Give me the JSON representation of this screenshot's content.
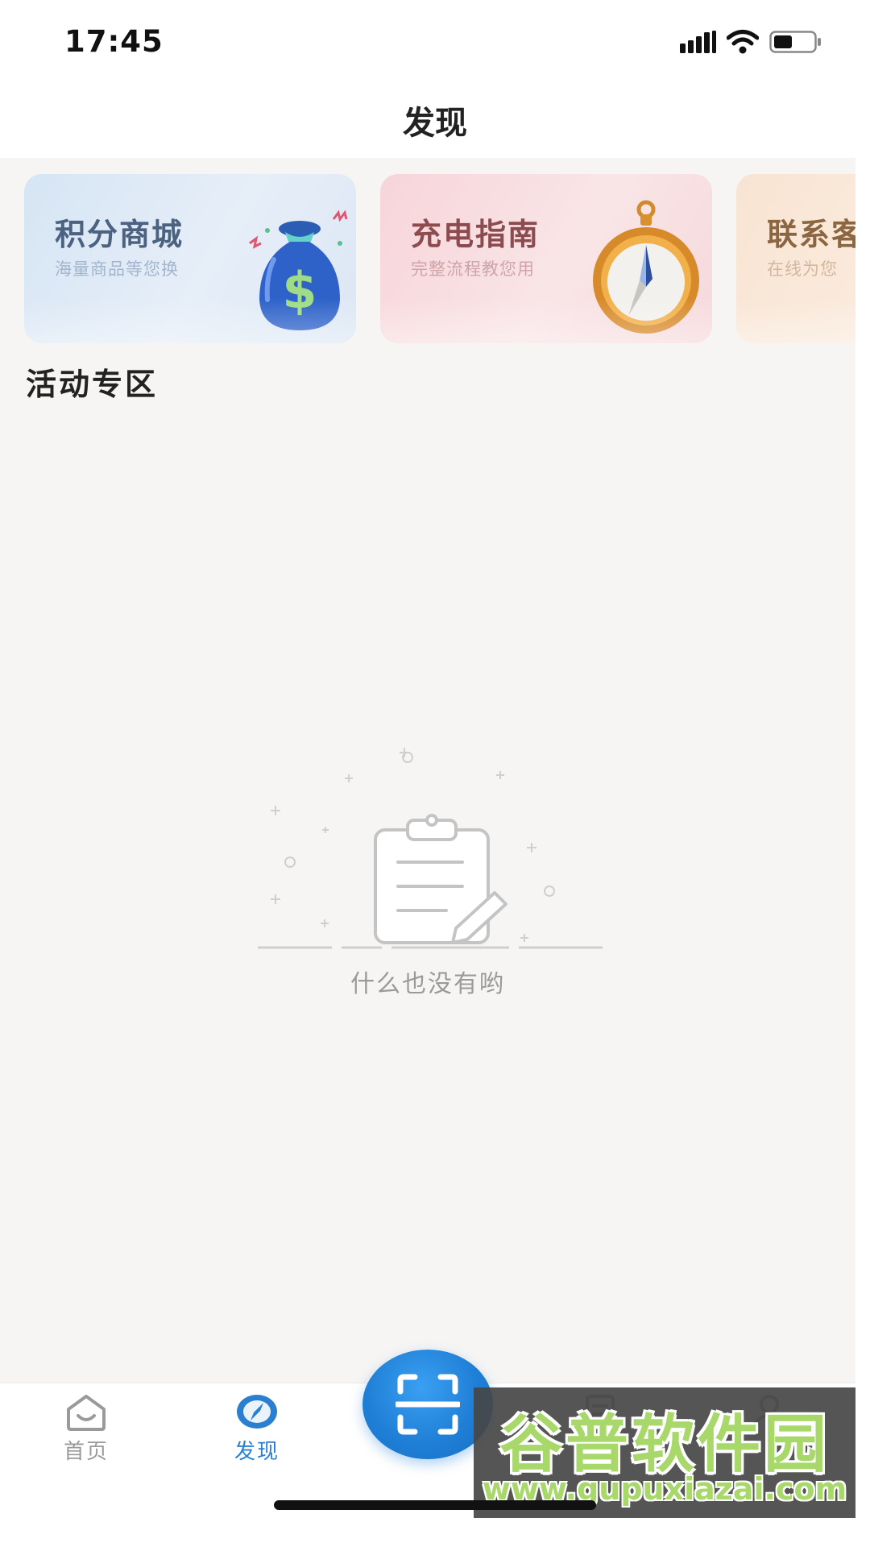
{
  "status_bar": {
    "time": "17:45",
    "icons": [
      "signal-icon",
      "wifi-icon",
      "battery-icon"
    ]
  },
  "header": {
    "title": "发现"
  },
  "feature_cards": [
    {
      "title": "积分商城",
      "subtitle": "海量商品等您换",
      "icon": "money-bag-icon",
      "color": "#d6e5f4"
    },
    {
      "title": "充电指南",
      "subtitle": "完整流程教您用",
      "icon": "compass-icon",
      "color": "#f7d5d9"
    },
    {
      "title": "联系客",
      "subtitle": "在线为您",
      "icon": "service-icon",
      "color": "#f8e4d2"
    }
  ],
  "section": {
    "title": "活动专区"
  },
  "empty_state": {
    "message": "什么也没有哟",
    "icon": "empty-clipboard-icon"
  },
  "tab_bar": {
    "items": [
      {
        "label": "首页",
        "icon": "home-icon",
        "active": false
      },
      {
        "label": "发现",
        "icon": "compass-icon",
        "active": true
      },
      {
        "label": "",
        "icon": "orders-icon",
        "active": false
      },
      {
        "label": "",
        "icon": "user-icon",
        "active": false
      }
    ],
    "scan_button_icon": "scan-icon",
    "active_color": "#2b7fd0",
    "inactive_color": "#9a9a9a"
  },
  "watermark": {
    "title": "谷普软件园",
    "url": "www.gupuxiazai.com"
  }
}
